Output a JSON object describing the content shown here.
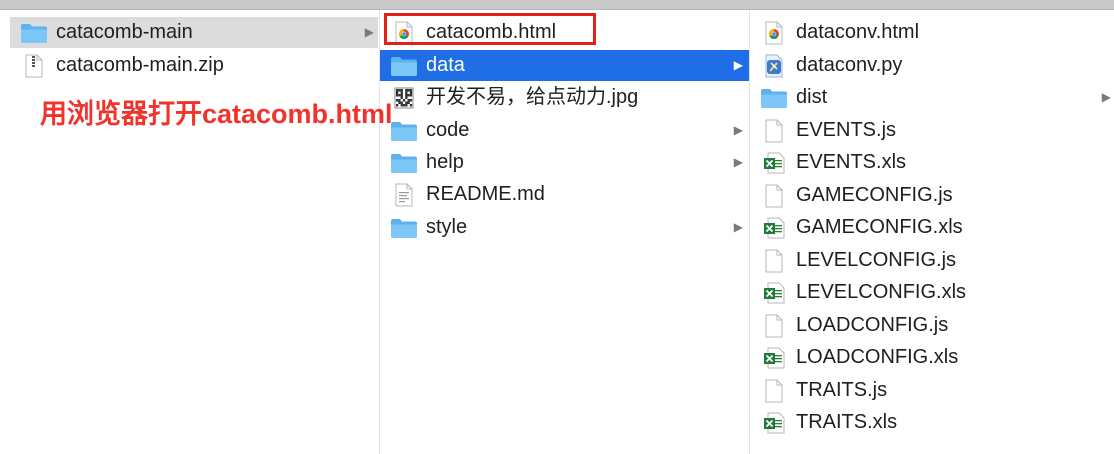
{
  "annotation": {
    "text": "用浏览器打开catacomb.html",
    "color": "#f1332b"
  },
  "highlight_color": "#e32018",
  "selection_color": "#1f6ee6",
  "columns": [
    {
      "items": [
        {
          "label": "catacomb-main",
          "icon": "folder-icon",
          "has_children": true,
          "state": "selected-inactive"
        },
        {
          "label": "catacomb-main.zip",
          "icon": "zip-file-icon",
          "has_children": false,
          "state": "normal"
        }
      ]
    },
    {
      "items": [
        {
          "label": "catacomb.html",
          "icon": "chrome-html-icon",
          "has_children": false,
          "state": "highlighted"
        },
        {
          "label": "data",
          "icon": "folder-icon",
          "has_children": true,
          "state": "selected"
        },
        {
          "label": "开发不易，给点动力.jpg",
          "icon": "qr-image-icon",
          "has_children": false,
          "state": "normal"
        },
        {
          "label": "code",
          "icon": "folder-icon",
          "has_children": true,
          "state": "normal"
        },
        {
          "label": "help",
          "icon": "folder-icon",
          "has_children": true,
          "state": "normal"
        },
        {
          "label": "README.md",
          "icon": "markdown-file-icon",
          "has_children": false,
          "state": "normal"
        },
        {
          "label": "style",
          "icon": "folder-icon",
          "has_children": true,
          "state": "normal"
        }
      ]
    },
    {
      "items": [
        {
          "label": "dataconv.html",
          "icon": "chrome-html-icon",
          "has_children": false
        },
        {
          "label": "dataconv.py",
          "icon": "python-file-icon",
          "has_children": false
        },
        {
          "label": "dist",
          "icon": "folder-icon",
          "has_children": true
        },
        {
          "label": "EVENTS.js",
          "icon": "blank-file-icon",
          "has_children": false
        },
        {
          "label": "EVENTS.xls",
          "icon": "excel-file-icon",
          "has_children": false
        },
        {
          "label": "GAMECONFIG.js",
          "icon": "blank-file-icon",
          "has_children": false
        },
        {
          "label": "GAMECONFIG.xls",
          "icon": "excel-file-icon",
          "has_children": false
        },
        {
          "label": "LEVELCONFIG.js",
          "icon": "blank-file-icon",
          "has_children": false
        },
        {
          "label": "LEVELCONFIG.xls",
          "icon": "excel-file-icon",
          "has_children": false
        },
        {
          "label": "LOADCONFIG.js",
          "icon": "blank-file-icon",
          "has_children": false
        },
        {
          "label": "LOADCONFIG.xls",
          "icon": "excel-file-icon",
          "has_children": false
        },
        {
          "label": "TRAITS.js",
          "icon": "blank-file-icon",
          "has_children": false
        },
        {
          "label": "TRAITS.xls",
          "icon": "excel-file-icon",
          "has_children": false
        }
      ]
    }
  ]
}
